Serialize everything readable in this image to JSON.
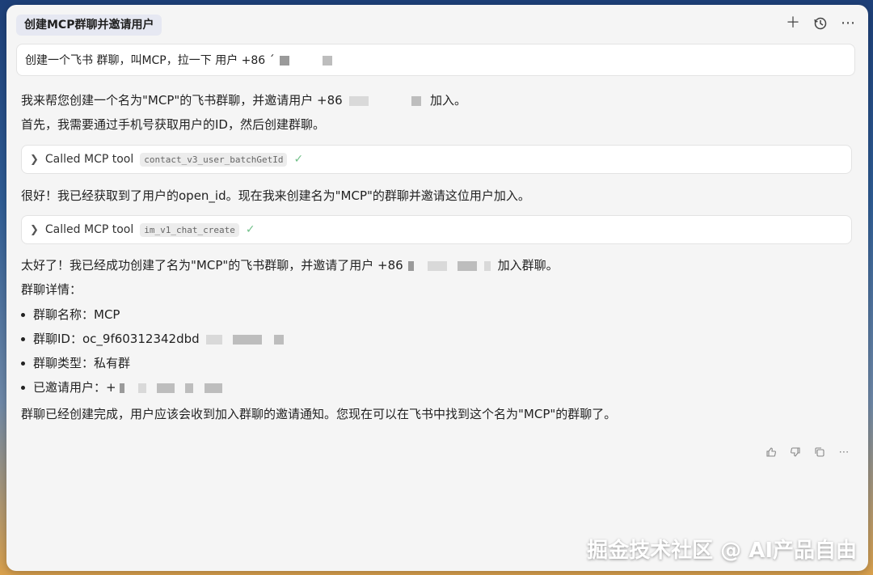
{
  "header": {
    "tab_title": "创建MCP群聊并邀请用户",
    "icons": [
      "plus-icon",
      "history-icon",
      "more-icon"
    ]
  },
  "prompt": {
    "text": "创建一个飞书 群聊，叫MCP，拉一下 用户 +86 ´"
  },
  "conversation": {
    "line1_prefix": "我来帮您创建一个名为\"MCP\"的飞书群聊，并邀请用户 +86",
    "line1_suffix": "加入。",
    "line2": "首先，我需要通过手机号获取用户的ID，然后创建群聊。",
    "tool1": {
      "label": "Called MCP tool",
      "name": "contact_v3_user_batchGetId"
    },
    "line3": "很好！我已经获取到了用户的open_id。现在我来创建名为\"MCP\"的群聊并邀请这位用户加入。",
    "tool2": {
      "label": "Called MCP tool",
      "name": "im_v1_chat_create"
    },
    "line4_prefix": "太好了！我已经成功创建了名为\"MCP\"的飞书群聊，并邀请了用户 +86",
    "line4_suffix": "加入群聊。",
    "details_heading": "群聊详情：",
    "bullets": [
      "群聊名称：MCP",
      "群聊ID：oc_9f60312342dbd",
      "群聊类型：私有群",
      "已邀请用户：+"
    ],
    "closing": "群聊已经创建完成，用户应该会收到加入群聊的邀请通知。您现在可以在飞书中找到这个名为\"MCP\"的群聊了。"
  },
  "footer": {
    "icons": [
      "thumbs-up-icon",
      "thumbs-down-icon",
      "copy-icon",
      "more-icon"
    ]
  },
  "watermark": "掘金技术社区 @ AI产品自由"
}
